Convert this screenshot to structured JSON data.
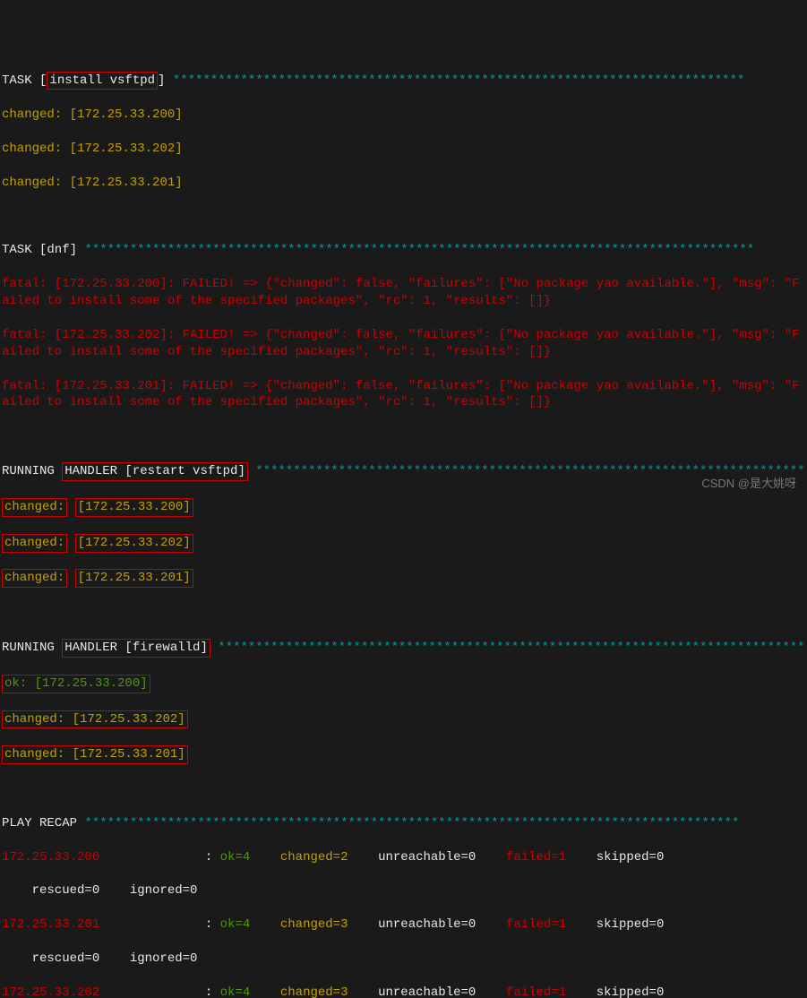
{
  "task1": {
    "prefix": "TASK [",
    "name": "install vsftpd",
    "suffix": "] ",
    "stars": "****************************************************************************",
    "results": [
      {
        "status": "changed: ",
        "host": "[172.25.33.200]"
      },
      {
        "status": "changed: ",
        "host": "[172.25.33.202]"
      },
      {
        "status": "changed: ",
        "host": "[172.25.33.201]"
      }
    ]
  },
  "task2": {
    "header": "TASK [dnf] ",
    "stars": "*****************************************************************************************",
    "errors": [
      "fatal: [172.25.33.200]: FAILED! => {\"changed\": false, \"failures\": [\"No package yao available.\"], \"msg\": \"Failed to install some of the specified packages\", \"rc\": 1, \"results\": []}",
      "fatal: [172.25.33.202]: FAILED! => {\"changed\": false, \"failures\": [\"No package yao available.\"], \"msg\": \"Failed to install some of the specified packages\", \"rc\": 1, \"results\": []}",
      "fatal: [172.25.33.201]: FAILED! => {\"changed\": false, \"failures\": [\"No package yao available.\"], \"msg\": \"Failed to install some of the specified packages\", \"rc\": 1, \"results\": []}"
    ]
  },
  "handler1": {
    "prefix": "RUNNING ",
    "boxed": "HANDLER [restart vsftpd]",
    "suffix": " ",
    "stars": "*************************************************************************",
    "results": [
      {
        "status": "changed:",
        "gap": " ",
        "host": "[172.25.33.200]"
      },
      {
        "status": "changed:",
        "gap": " ",
        "host": "[172.25.33.202]"
      },
      {
        "status": "changed:",
        "gap": " ",
        "host": "[172.25.33.201]"
      }
    ]
  },
  "handler2": {
    "prefix": "RUNNING ",
    "boxed": "HANDLER [firewalld]",
    "suffix": " ",
    "stars": "******************************************************************************",
    "results": [
      {
        "status": "ok: [172.25.33.200]",
        "class": "green"
      },
      {
        "status": "changed: ",
        "host": "[172.25.33.202]",
        "class": "yellow"
      },
      {
        "status": "changed: ",
        "host": "[172.25.33.201]",
        "class": "yellow"
      }
    ]
  },
  "recap": {
    "header": "PLAY RECAP ",
    "stars": "***************************************************************************************",
    "rows": [
      {
        "host": "172.25.33.200",
        "pad": "              : ",
        "ok": "ok=4",
        "changed": "changed=2",
        "unreachable": "unreachable=0",
        "failed": "failed=1",
        "skipped": "skipped=0",
        "line2": "    rescued=0    ignored=0"
      },
      {
        "host": "172.25.33.201",
        "pad": "              : ",
        "ok": "ok=4",
        "changed": "changed=3",
        "unreachable": "unreachable=0",
        "failed": "failed=1",
        "skipped": "skipped=0",
        "line2": "    rescued=0    ignored=0"
      },
      {
        "host": "172.25.33.202",
        "pad": "              : ",
        "ok": "ok=4",
        "changed": "changed=3",
        "unreachable": "unreachable=0",
        "failed": "failed=1",
        "skipped": "skipped=0"
      }
    ]
  },
  "watermark": "CSDN @是大姚呀"
}
